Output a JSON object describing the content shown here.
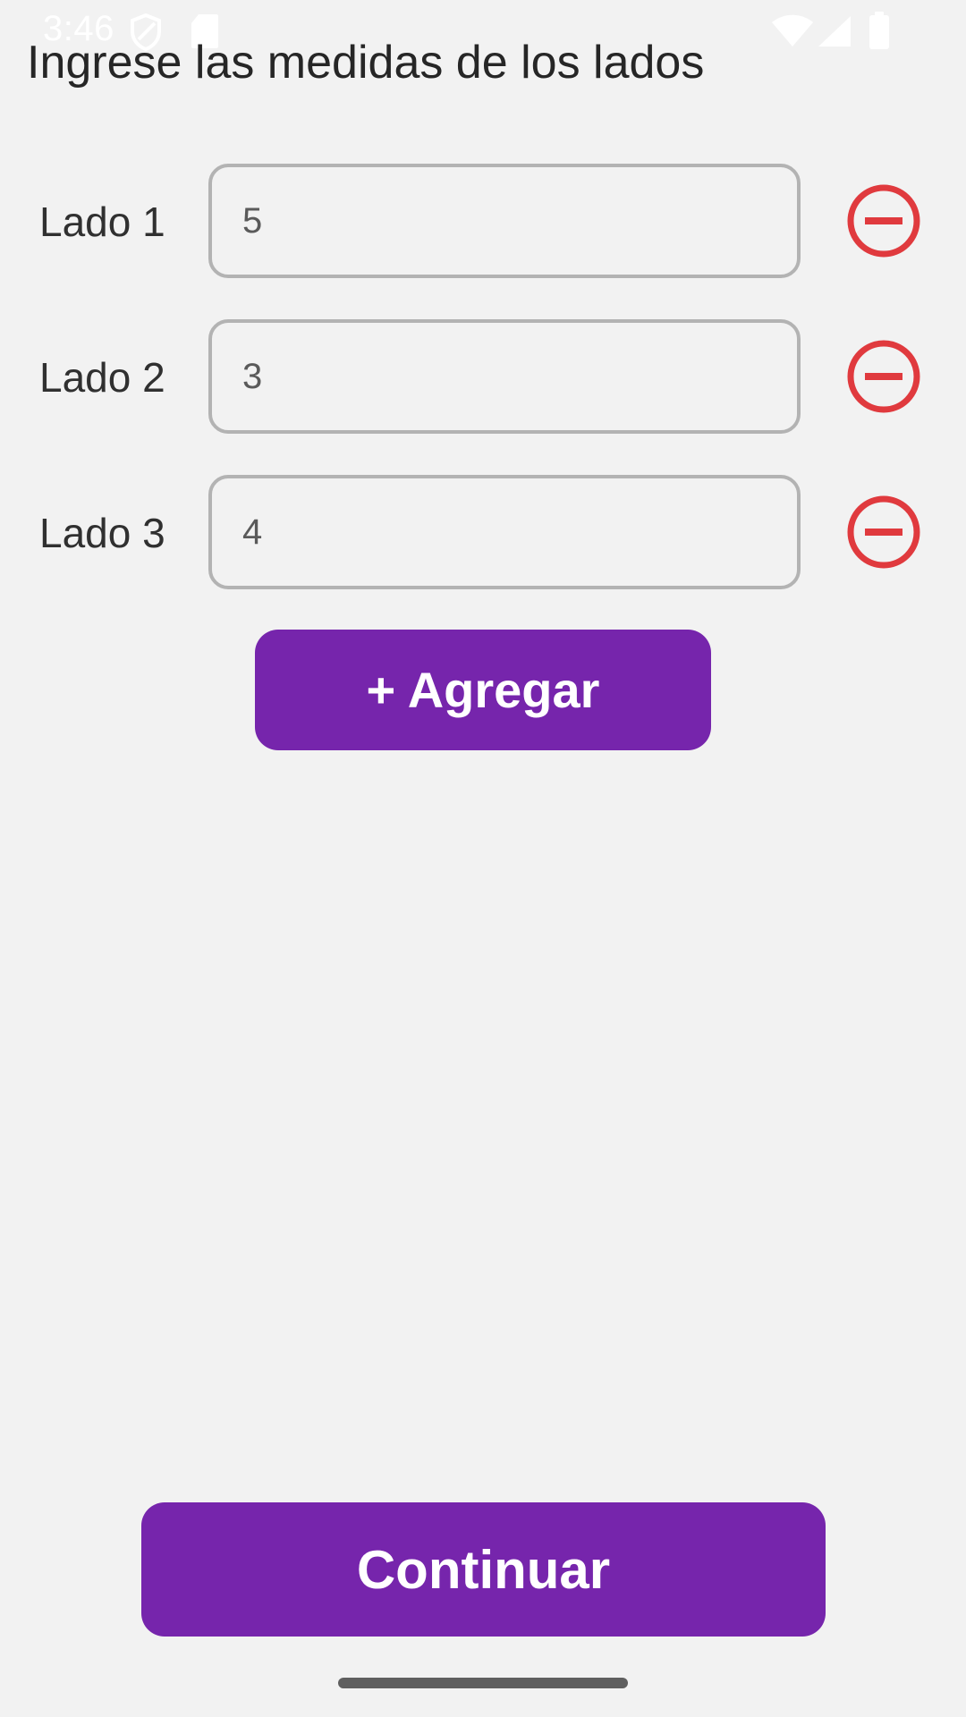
{
  "status_bar": {
    "time": "3:46",
    "icons": [
      "shield-icon",
      "sd-card-icon",
      "wifi-icon",
      "signal-icon",
      "battery-icon"
    ]
  },
  "title": "Ingrese las medidas de los lados",
  "sides": [
    {
      "label": "Lado 1",
      "value": "5"
    },
    {
      "label": "Lado 2",
      "value": "3"
    },
    {
      "label": "Lado 3",
      "value": "4"
    }
  ],
  "add_button": {
    "label": "+ Agregar"
  },
  "continue_button": {
    "label": "Continuar"
  },
  "colors": {
    "background": "#f2f2f2",
    "accent": "#7625ac",
    "remove": "#e03a3e",
    "input_border": "#b3b3b3",
    "text": "#303030"
  }
}
